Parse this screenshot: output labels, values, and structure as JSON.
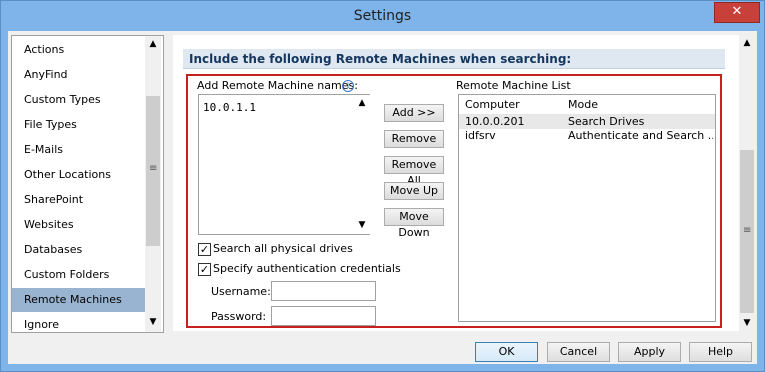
{
  "window": {
    "title": "Settings",
    "close_glyph": "✕"
  },
  "sidebar": {
    "items": [
      {
        "label": "Actions"
      },
      {
        "label": "AnyFind"
      },
      {
        "label": "Custom Types"
      },
      {
        "label": "File Types"
      },
      {
        "label": "E-Mails"
      },
      {
        "label": "Other Locations"
      },
      {
        "label": "SharePoint"
      },
      {
        "label": "Websites"
      },
      {
        "label": "Databases"
      },
      {
        "label": "Custom Folders"
      },
      {
        "label": "Remote Machines",
        "selected": true
      },
      {
        "label": "Ignore"
      }
    ]
  },
  "main": {
    "header": "Include the following Remote Machines when searching:",
    "add_label": "Add Remote Machine names:",
    "info_icon": "i",
    "names_value": "10.0.1.1",
    "buttons": {
      "add": "Add >>",
      "remove": "Remove",
      "remove_all": "Remove All",
      "move_up": "Move Up",
      "move_down": "Move Down"
    },
    "list_label": "Remote Machine List",
    "list_columns": [
      "Computer",
      "Mode"
    ],
    "list_rows": [
      {
        "computer": "10.0.0.201",
        "mode": "Search Drives"
      },
      {
        "computer": "idfsrv",
        "mode": "Authenticate and Search ..."
      }
    ],
    "search_all_drives": {
      "label": "Search all physical drives",
      "checked": true
    },
    "specify_credentials": {
      "label": "Specify authentication credentials",
      "checked": true
    },
    "username_label": "Username:",
    "password_label": "Password:",
    "username_value": "",
    "password_value": ""
  },
  "dialog_buttons": {
    "ok": "OK",
    "cancel": "Cancel",
    "apply": "Apply",
    "help": "Help"
  },
  "scroll_glyphs": {
    "up": "▲",
    "down": "▼",
    "grip": "≡"
  },
  "colors": {
    "selection": "#99b4d1",
    "frame_highlight": "#c62020",
    "title_bar": "#7eb4ea"
  }
}
